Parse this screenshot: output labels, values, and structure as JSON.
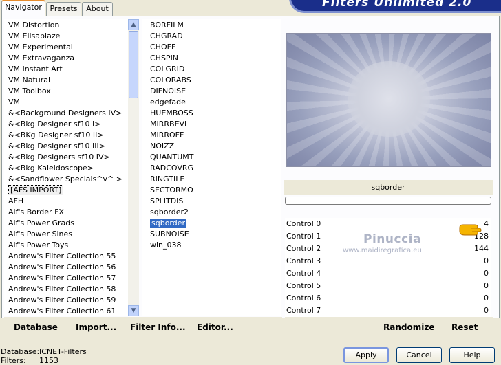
{
  "tabs": [
    "Navigator",
    "Presets",
    "About"
  ],
  "banner_title": "Filters Unlimited 2.0",
  "categories": [
    "VM Distortion",
    "VM Elisablaze",
    "VM Experimental",
    "VM Extravaganza",
    "VM Instant Art",
    "VM Natural",
    "VM Toolbox",
    "VM",
    "&<Background Designers IV>",
    "&<Bkg Designer sf10 I>",
    "&<BKg Designer sf10 II>",
    "&<Bkg Designer sf10 III>",
    "&<Bkg Designers sf10 IV>",
    "&<Bkg Kaleidoscope>",
    "&<Sandflower Specials^v^ >",
    "[AFS IMPORT]",
    "AFH",
    "Alf's Border FX",
    "Alf's Power Grads",
    "Alf's Power Sines",
    "Alf's Power Toys",
    "Andrew's Filter Collection 55",
    "Andrew's Filter Collection 56",
    "Andrew's Filter Collection 57",
    "Andrew's Filter Collection 58",
    "Andrew's Filter Collection 59",
    "Andrew's Filter Collection 61"
  ],
  "selected_category": "[AFS IMPORT]",
  "filters": [
    "BORFILM",
    "CHGRAD",
    "CHOFF",
    "CHSPIN",
    "COLGRID",
    "COLORABS",
    "DIFNOISE",
    "edgefade",
    "HUEMBOSS",
    "MIRRBEVL",
    "MIRROFF",
    "NOIZZ",
    "QUANTUMT",
    "RADCOVRG",
    "RINGTILE",
    "SECTORMO",
    "SPLITDIS",
    "sqborder2",
    "sqborder",
    "SUBNOISE",
    "win_038"
  ],
  "selected_filter": "sqborder",
  "filter_name": "sqborder",
  "controls": [
    {
      "label": "Control 0",
      "value": "4"
    },
    {
      "label": "Control 1",
      "value": "128"
    },
    {
      "label": "Control 2",
      "value": "144"
    },
    {
      "label": "Control 3",
      "value": "0"
    },
    {
      "label": "Control 4",
      "value": "0"
    },
    {
      "label": "Control 5",
      "value": "0"
    },
    {
      "label": "Control 6",
      "value": "0"
    },
    {
      "label": "Control 7",
      "value": "0"
    }
  ],
  "toolbar": {
    "database": "Database",
    "import": "Import...",
    "filter_info": "Filter Info...",
    "editor": "Editor...",
    "randomize": "Randomize",
    "reset": "Reset"
  },
  "watermark": {
    "name": "Pinuccia",
    "url": "www.maidiregrafica.eu"
  },
  "status": {
    "database_label": "Database:",
    "database_value": "ICNET-Filters",
    "filters_label": "Filters:",
    "filters_value": "1153"
  },
  "buttons": {
    "apply": "Apply",
    "cancel": "Cancel",
    "help": "Help"
  },
  "colors": {
    "selection": "#316ac5",
    "banner": "#1a2e8a",
    "tab_accent": "#e68b2c"
  }
}
